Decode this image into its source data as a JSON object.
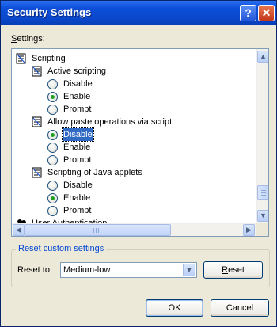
{
  "window": {
    "title": "Security Settings"
  },
  "title_buttons": {
    "help": "?",
    "close": "✕"
  },
  "settings_label": {
    "mnemonic": "S",
    "rest": "ettings:"
  },
  "tree": {
    "category": "Scripting",
    "groups": [
      {
        "label": "Active scripting",
        "options": [
          {
            "label": "Disable",
            "selected": false
          },
          {
            "label": "Enable",
            "selected": true
          },
          {
            "label": "Prompt",
            "selected": false
          }
        ]
      },
      {
        "label": "Allow paste operations via script",
        "options": [
          {
            "label": "Disable",
            "selected": true
          },
          {
            "label": "Enable",
            "selected": false
          },
          {
            "label": "Prompt",
            "selected": false
          }
        ]
      },
      {
        "label": "Scripting of Java applets",
        "options": [
          {
            "label": "Disable",
            "selected": false
          },
          {
            "label": "Enable",
            "selected": true
          },
          {
            "label": "Prompt",
            "selected": false
          }
        ]
      }
    ],
    "next_category_partial": "User Authentication"
  },
  "reset_group": {
    "title": "Reset custom settings",
    "reset_to_label": "Reset to:",
    "selected_level": "Medium-low",
    "reset_button": {
      "mnemonic_before": "",
      "mnemonic": "R",
      "rest": "eset"
    }
  },
  "footer": {
    "ok": "OK",
    "cancel": "Cancel"
  },
  "colors": {
    "title_bar": "#0a49cf",
    "selection": "#316ac5",
    "group_title": "#0046d5",
    "radio_dot": "#21a121"
  }
}
